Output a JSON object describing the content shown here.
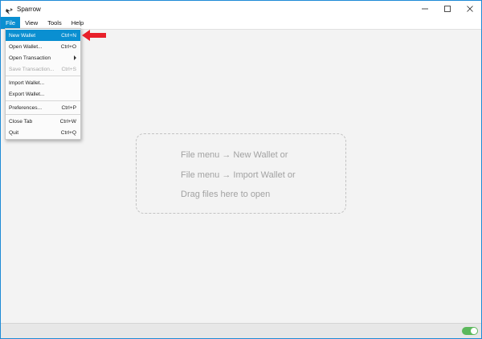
{
  "window": {
    "title": "Sparrow",
    "accent_color": "#0a8fd1"
  },
  "menubar": {
    "items": [
      {
        "label": "File"
      },
      {
        "label": "View"
      },
      {
        "label": "Tools"
      },
      {
        "label": "Help"
      }
    ]
  },
  "file_menu": {
    "new_wallet": {
      "label": "New Wallet",
      "shortcut": "Ctrl+N"
    },
    "open_wallet": {
      "label": "Open Wallet...",
      "shortcut": "Ctrl+O"
    },
    "open_transaction": {
      "label": "Open Transaction"
    },
    "save_transaction": {
      "label": "Save Transaction...",
      "shortcut": "Ctrl+S"
    },
    "import_wallet": {
      "label": "Import Wallet..."
    },
    "export_wallet": {
      "label": "Export Wallet..."
    },
    "preferences": {
      "label": "Preferences...",
      "shortcut": "Ctrl+P"
    },
    "close_tab": {
      "label": "Close Tab",
      "shortcut": "Ctrl+W"
    },
    "quit": {
      "label": "Quit",
      "shortcut": "Ctrl+Q"
    }
  },
  "drop_zone": {
    "line1": "File menu → New Wallet or",
    "line2": "File menu → Import Wallet or",
    "line3": "Drag files here to open"
  },
  "status": {
    "toggle_on": true,
    "toggle_color": "#5cb85c"
  }
}
